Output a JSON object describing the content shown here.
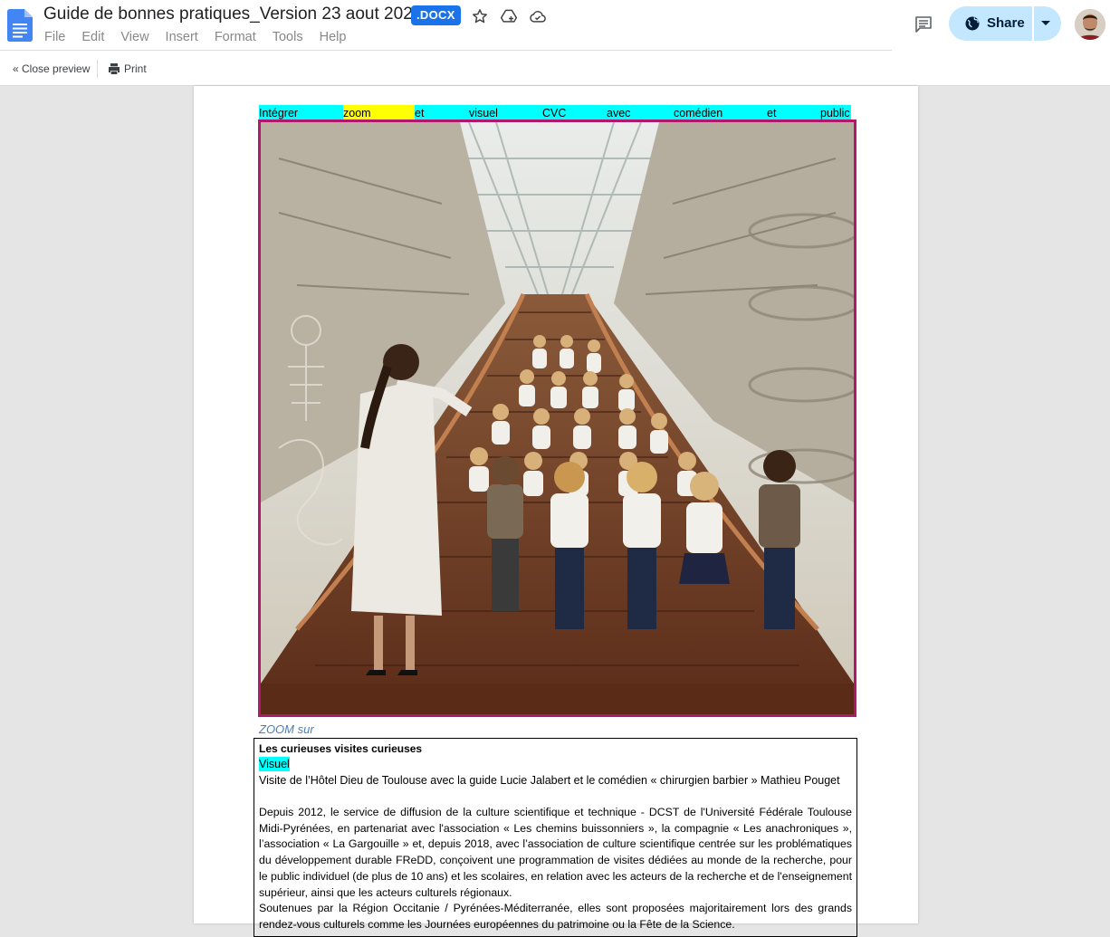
{
  "document": {
    "title": "Guide de bonnes pratiques_Version 23 aout 2022",
    "format_badge": ".DOCX"
  },
  "menu": [
    "File",
    "Edit",
    "View",
    "Insert",
    "Format",
    "Tools",
    "Help"
  ],
  "share": {
    "label": "Share"
  },
  "preview_bar": {
    "close_label": "« Close preview",
    "print_label": "Print"
  },
  "page": {
    "caption_words": [
      "Intégrer",
      "zoom",
      "et",
      "visuel",
      "CVC",
      "avec",
      "comédien",
      "et",
      "public"
    ],
    "zoom_sur": "ZOOM sur",
    "textbox": {
      "title": "Les curieuses visites curieuses",
      "visuel": "Visuel",
      "subtitle": "Visite de l’Hôtel Dieu de Toulouse avec la guide Lucie Jalabert et le comédien « chirurgien barbier » Mathieu Pouget",
      "paragraph1": "Depuis 2012, le service de diffusion de la culture scientifique et technique - DCST de l'Université Fédérale Toulouse Midi-Pyrénées, en partenariat avec l'association « Les chemins buissonniers », la compagnie « Les anachroniques », l’association « La Gargouille » et, depuis 2018, avec l’association de culture scientifique centrée sur les problématiques du développement durable FReDD,  conçoivent une programmation de visites dédiées au monde de la recherche, pour le public individuel (de plus de 10 ans) et les scolaires, en relation avec les acteurs de la recherche et de l'enseignement supérieur, ainsi que les acteurs culturels régionaux.",
      "paragraph2": "Soutenues par la Région Occitanie / Pyrénées-Méditerranée, elles sont proposées majoritairement lors des grands rendez-vous culturels comme les Journées européennes du patrimoine ou la Fête de la Science."
    }
  },
  "colors": {
    "docs_blue": "#4285f4",
    "badge_blue": "#1a73e8",
    "share_bg": "#c2e7ff",
    "highlight_cyan": "#00ffff",
    "highlight_yellow": "#ffff00",
    "image_border": "#b0186b"
  }
}
